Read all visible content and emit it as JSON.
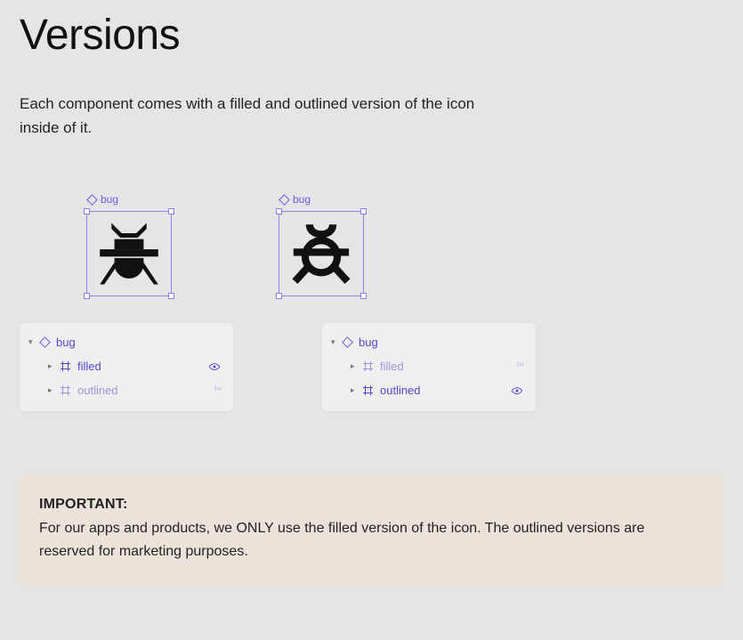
{
  "title": "Versions",
  "intro": "Each component comes with a filled and outlined version of the icon inside of it.",
  "examples": {
    "left": {
      "component_label": "bug"
    },
    "right": {
      "component_label": "bug"
    }
  },
  "panels": {
    "left": {
      "head": "bug",
      "row_filled": "filled",
      "row_outlined": "outlined"
    },
    "right": {
      "head": "bug",
      "row_filled": "filled",
      "row_outlined": "outlined"
    }
  },
  "notice": {
    "heading": "IMPORTANT:",
    "body": "For our apps and products, we ONLY use the filled version of the icon. The outlined versions are reserved for marketing purposes."
  }
}
